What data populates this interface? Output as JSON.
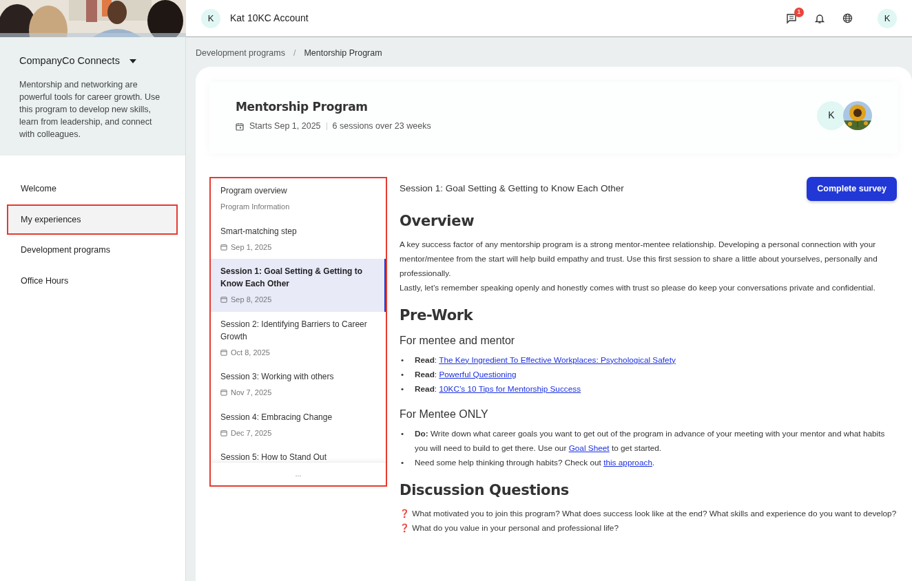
{
  "topbar": {
    "avatar": "K",
    "account": "Kat 10KC Account",
    "messages_badge": "1",
    "user_avatar": "K"
  },
  "sidebar": {
    "program": "CompanyCo Connects",
    "description": "Mentorship and networking are powerful tools for career growth. Use this program to develop new skills, learn from leadership, and connect with colleagues.",
    "items": [
      {
        "label": "Welcome",
        "selected": false
      },
      {
        "label": "My experiences",
        "selected": true
      },
      {
        "label": "Development programs",
        "selected": false
      },
      {
        "label": "Office Hours",
        "selected": false
      }
    ]
  },
  "breadcrumb": [
    "Development programs",
    "/",
    "Mentorship Program"
  ],
  "program": {
    "title": "Mentorship Program",
    "starts": "Starts Sep 1, 2025",
    "sessions": "6 sessions over 23 weeks",
    "avatar": "K"
  },
  "steps": [
    {
      "title": "Program overview",
      "subtitle": "Program Information",
      "selected": false
    },
    {
      "title": "Smart-matching step",
      "date": "Sep 1, 2025",
      "selected": false
    },
    {
      "title": "Session 1: Goal Setting & Getting to Know Each Other",
      "date": "Sep 8, 2025",
      "selected": true
    },
    {
      "title": "Session 2: Identifying Barriers to Career Growth",
      "date": "Oct 8, 2025",
      "selected": false
    },
    {
      "title": "Session 3: Working with others",
      "date": "Nov 7, 2025",
      "selected": false
    },
    {
      "title": "Session 4: Embracing Change",
      "date": "Dec 7, 2025",
      "selected": false
    },
    {
      "title": "Session 5: How to Stand Out",
      "selected": false
    }
  ],
  "more": "...",
  "session": {
    "title": "Session 1: Goal Setting & Getting to Know Each Other",
    "button": "Complete survey",
    "blocks": [
      {
        "kind": "h2",
        "text": "Overview"
      },
      {
        "kind": "p",
        "parts": [
          {
            "kind": "text",
            "text": "A key success factor of any mentorship program is a strong mentor‑mentee relationship. Developing a personal connection with your mentor/mentee from the start will help build empathy and trust. Use this first session to share a little about yourselves, personally and professionally."
          }
        ]
      },
      {
        "kind": "p",
        "parts": [
          {
            "kind": "text",
            "text": "Lastly, let’s remember speaking openly and honestly comes with trust so please do keep your conversations private and confidential."
          }
        ]
      },
      {
        "kind": "h2",
        "text": "Pre-Work"
      },
      {
        "kind": "h3",
        "text": "For mentee and mentor"
      },
      {
        "kind": "ul",
        "bullet": "•",
        "items": [
          [
            {
              "kind": "bold",
              "text": "Read"
            },
            {
              "kind": "text",
              "text": ": "
            },
            {
              "kind": "link",
              "text": "The Key Ingredient To Effective Workplaces: Psychological Safety"
            }
          ],
          [
            {
              "kind": "bold",
              "text": "Read"
            },
            {
              "kind": "text",
              "text": ": "
            },
            {
              "kind": "link",
              "text": "Powerful Questioning"
            }
          ],
          [
            {
              "kind": "bold",
              "text": "Read"
            },
            {
              "kind": "text",
              "text": ": "
            },
            {
              "kind": "link",
              "text": "10KC’s 10 Tips for Mentorship Success"
            }
          ]
        ]
      },
      {
        "kind": "h3",
        "text": "For Mentee ONLY"
      },
      {
        "kind": "ul",
        "bullet": "•",
        "items": [
          [
            {
              "kind": "bold",
              "text": "Do:"
            },
            {
              "kind": "text",
              "text": " Write down what career goals you want to get out of the program in advance of your meeting with your mentor and what habits you will need to build to get there. Use our "
            },
            {
              "kind": "link",
              "text": "Goal Sheet"
            },
            {
              "kind": "text",
              "text": " to get started."
            }
          ],
          [
            {
              "kind": "text",
              "text": "Need some help thinking through habits? Check out "
            },
            {
              "kind": "link",
              "text": "this approach"
            },
            {
              "kind": "text",
              "text": "."
            }
          ]
        ]
      },
      {
        "kind": "h2",
        "text": "Discussion Questions"
      },
      {
        "kind": "q",
        "icon": "❓",
        "text": "What motivated you to join this program? What does success look like at the end? What skills and experience do you want to develop?"
      },
      {
        "kind": "q",
        "icon": "❓",
        "text": "What do you value in your personal and professional life?"
      }
    ]
  }
}
